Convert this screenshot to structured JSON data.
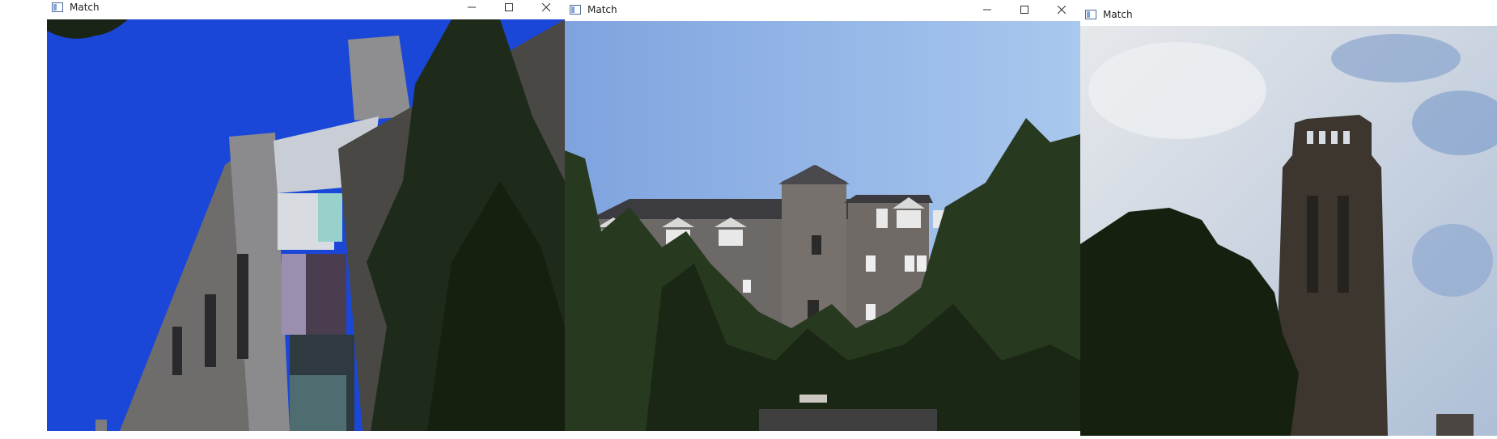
{
  "windows": [
    {
      "title": "Match",
      "controls": [
        "minimize-icon",
        "maximize-icon",
        "close-icon"
      ],
      "image_description_colors": {
        "sky": "#1b47d8",
        "stone": "#8a8a8e",
        "tree": "#1c2a18"
      }
    },
    {
      "title": "Match",
      "controls": [
        "minimize-icon",
        "maximize-icon",
        "close-icon"
      ],
      "image_description_colors": {
        "sky": "#86aee6",
        "stone": "#6e6a66",
        "tree": "#27391f"
      }
    },
    {
      "title": "Match",
      "controls": [],
      "image_description_colors": {
        "sky": "#d6dbe2",
        "tower": "#3c362f",
        "tree": "#16200f"
      }
    }
  ]
}
